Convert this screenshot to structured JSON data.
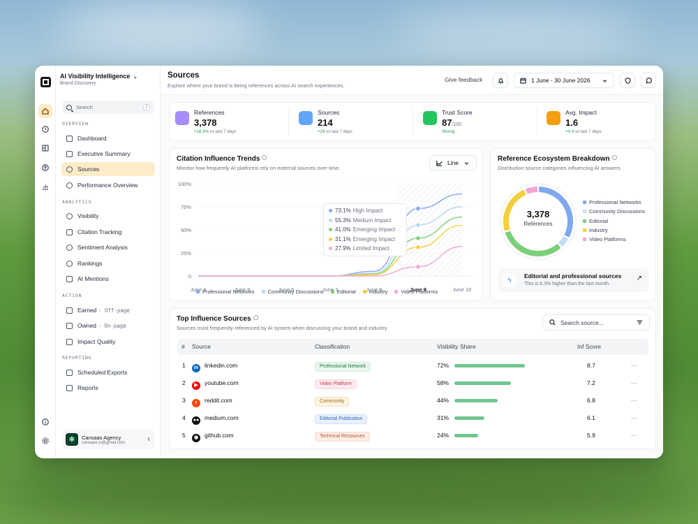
{
  "workspace": {
    "name": "AI Visibility Intelligence",
    "subtitle": "Brand Discovery",
    "chevron": "⌄"
  },
  "search": {
    "placeholder": "Search",
    "shortcut": "/"
  },
  "sidebar": {
    "sections": [
      {
        "title": "OVERVIEW",
        "items": [
          {
            "label": "Dashboard"
          },
          {
            "label": "Executive Summary"
          },
          {
            "label": "Sources",
            "active": true
          },
          {
            "label": "Performance Overview"
          }
        ]
      },
      {
        "title": "ANALYTICS",
        "items": [
          {
            "label": "Visibility"
          },
          {
            "label": "Citation Tracking"
          },
          {
            "label": "Sentiment Analysis"
          },
          {
            "label": "Rankings"
          },
          {
            "label": "AI Mentions"
          }
        ]
      },
      {
        "title": "ACTION",
        "items": [
          {
            "label": "Earned",
            "tag": "- Off-page"
          },
          {
            "label": "Owned",
            "tag": "- On-page"
          },
          {
            "label": "Impact Quality"
          }
        ]
      },
      {
        "title": "REPORTING",
        "items": [
          {
            "label": "Scheduled Exports"
          },
          {
            "label": "Reports"
          }
        ]
      }
    ],
    "account": {
      "name": "Cansaas Agency",
      "email": "cansaas.io@gmail.com"
    }
  },
  "header": {
    "title": "Sources",
    "subtitle": "Explore where your brand is being references across AI search experiences.",
    "feedback": "Give feedback",
    "date_range": "1 June - 30 June 2026"
  },
  "kpis": [
    {
      "label": "References",
      "value": "3,378",
      "delta": "+18,5%",
      "delta_note": "vs last 7 days",
      "color": "#a78bfa"
    },
    {
      "label": "Sources",
      "value": "214",
      "delta": "+24",
      "delta_note": "vs last 7 days",
      "color": "#60a5fa"
    },
    {
      "label": "Trust Score",
      "value": "87",
      "value_suffix": "/100",
      "delta": "Strong",
      "delta_note": "",
      "color": "#22c55e"
    },
    {
      "label": "Avg. Impact",
      "value": "1.6",
      "delta": "+0.4",
      "delta_note": "vs last 7 days",
      "color": "#f59e0b"
    }
  ],
  "trends": {
    "title": "Citation Influence Trends",
    "subtitle": "Monitor how frequently AI platforms rely on external sources over time.",
    "mode": "Line",
    "tooltip": [
      {
        "value": "73.1%",
        "label": "High Impact",
        "color": "#7fa8ee"
      },
      {
        "value": "55.3%",
        "label": "Medium Impact",
        "color": "#b9d6f2"
      },
      {
        "value": "41.0%",
        "label": "Emerging Impact",
        "color": "#7ccf7a"
      },
      {
        "value": "31.1%",
        "label": "Emerging Impact",
        "color": "#f4cf3c"
      },
      {
        "value": "27.9%",
        "label": "Limited Impact",
        "color": "#f3a6d6"
      }
    ]
  },
  "chart_data": {
    "type": "line",
    "x": [
      "June 4",
      "June 5",
      "June 6",
      "June 7",
      "June 8",
      "June 9",
      "June 10"
    ],
    "y_ticks": [
      "0",
      "25%",
      "50%",
      "75%",
      "100%"
    ],
    "ylim": [
      0,
      100
    ],
    "highlight_x": "June 9",
    "series": [
      {
        "name": "Professional Networks",
        "color": "#7fa8ee",
        "values": [
          0,
          0,
          0,
          0,
          5,
          73.1,
          89
        ]
      },
      {
        "name": "Community Discussions",
        "color": "#b9d6f2",
        "values": [
          0,
          0,
          0,
          0,
          3,
          55.3,
          75
        ]
      },
      {
        "name": "Editorial",
        "color": "#7ccf7a",
        "values": [
          0,
          0,
          0,
          0,
          2,
          41.0,
          64
        ]
      },
      {
        "name": "Industry",
        "color": "#f4cf3c",
        "values": [
          0,
          0,
          0,
          0,
          1.5,
          31.1,
          55
        ]
      },
      {
        "name": "Video Platforms",
        "color": "#f3a6d6",
        "values": [
          0,
          0,
          0,
          0,
          0,
          10,
          32
        ]
      }
    ]
  },
  "ecosystem": {
    "title": "Reference Ecosystem Breakdown",
    "subtitle": "Distribution source categories influencing AI answers.",
    "total": "3,378",
    "total_label": "References",
    "segments": [
      {
        "name": "Professional Networks",
        "color": "#7fa8ee",
        "value": 31
      },
      {
        "name": "Community Discussions",
        "color": "#c4ddf3",
        "value": 5
      },
      {
        "name": "Editorial",
        "color": "#7ccf7a",
        "value": 30
      },
      {
        "name": "Industry",
        "color": "#f4cf3c",
        "value": 22
      },
      {
        "name": "Video Platforms",
        "color": "#f3a6d6",
        "value": 6
      }
    ],
    "insight": {
      "title": "Editorial and professional sources",
      "text": "This is 6.3% higher than the last month."
    }
  },
  "sources_table": {
    "title": "Top Influence Sources",
    "subtitle": "Sources most frequently referenced by AI system when discussing your brand and industry.",
    "search_placeholder": "Search source...",
    "columns": [
      "#",
      "Source",
      "Classification",
      "Visibility Share",
      "Inf Score"
    ],
    "rows": [
      {
        "rank": "1",
        "source": "linkedin.com",
        "classification": "Professional Network",
        "share": "72%",
        "share_value": 72,
        "score": "8.7",
        "icon_color": "#0a66c2",
        "icon_glyph": "in",
        "pill_bg": "#e7f6ec",
        "pill_fg": "#1f7a43",
        "pill_border": "#cdeed8"
      },
      {
        "rank": "2",
        "source": "youtube.com",
        "classification": "Video Platform",
        "share": "58%",
        "share_value": 58,
        "score": "7.2",
        "icon_color": "#ff0000",
        "icon_glyph": "▶",
        "pill_bg": "#fdecef",
        "pill_fg": "#c0344f",
        "pill_border": "#f8d3db"
      },
      {
        "rank": "3",
        "source": "reddit.com",
        "classification": "Community",
        "share": "44%",
        "share_value": 44,
        "score": "6.8",
        "icon_color": "#ff4500",
        "icon_glyph": "r",
        "pill_bg": "#fdf4e0",
        "pill_fg": "#9a6a12",
        "pill_border": "#f5e4b8"
      },
      {
        "rank": "4",
        "source": "medium.com",
        "classification": "Editorial Publication",
        "share": "31%",
        "share_value": 31,
        "score": "6.1",
        "icon_color": "#111111",
        "icon_glyph": "●●",
        "pill_bg": "#e8f1fc",
        "pill_fg": "#2c63b5",
        "pill_border": "#cfe0f7"
      },
      {
        "rank": "5",
        "source": "github.com",
        "classification": "Technical Resources",
        "share": "24%",
        "share_value": 24,
        "score": "5.9",
        "icon_color": "#111111",
        "icon_glyph": "◉",
        "pill_bg": "#fdeee6",
        "pill_fg": "#b5562a",
        "pill_border": "#f7d9c9"
      }
    ],
    "row_menu": "⋯"
  }
}
